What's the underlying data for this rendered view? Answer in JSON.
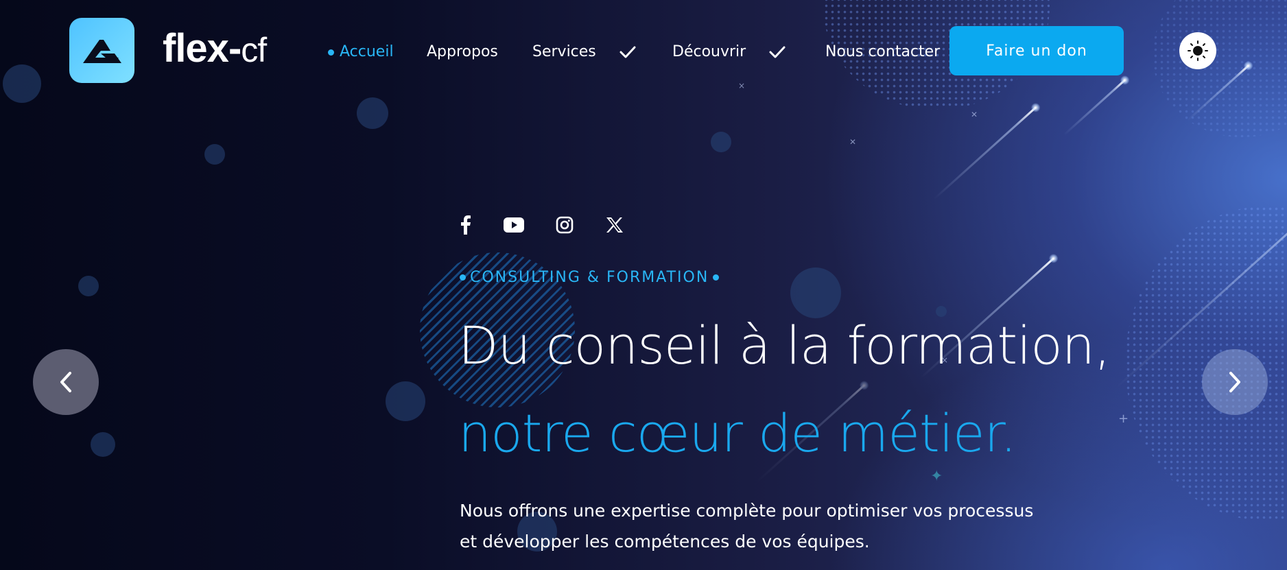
{
  "brand": {
    "logo_alt": "flex-cf logo",
    "name_bold": "flex",
    "name_separator": "-",
    "name_light": "cf",
    "logo_color": "#4fc3ff"
  },
  "nav": {
    "items": [
      {
        "label": "Accueil",
        "active": true
      },
      {
        "label": "Appropos",
        "active": false
      },
      {
        "label": "Services",
        "active": false,
        "has_dropdown": true
      },
      {
        "label": "Découvrir",
        "active": false,
        "has_dropdown": true
      },
      {
        "label": "Nous contacter",
        "active": false
      }
    ],
    "donate_label": "Faire un don",
    "theme_toggle_icon": "sun-icon"
  },
  "social": {
    "icons": [
      "facebook-icon",
      "youtube-icon",
      "instagram-icon",
      "x-icon"
    ]
  },
  "hero": {
    "eyebrow": "CONSULTING & FORMATION",
    "headline_plain": "Du conseil à la formation, ",
    "headline_accent": "notre cœur de métier.",
    "lead": "Nous offrons une expertise complète pour optimiser vos processus et développer les compétences de vos équipes."
  },
  "carousel": {
    "prev_icon": "chevron-left-icon",
    "next_icon": "chevron-right-icon"
  },
  "colors": {
    "accent": "#29b6f6",
    "button": "#0ba9f0",
    "background_dark": "#05081a",
    "background_light": "#2d3a78"
  }
}
